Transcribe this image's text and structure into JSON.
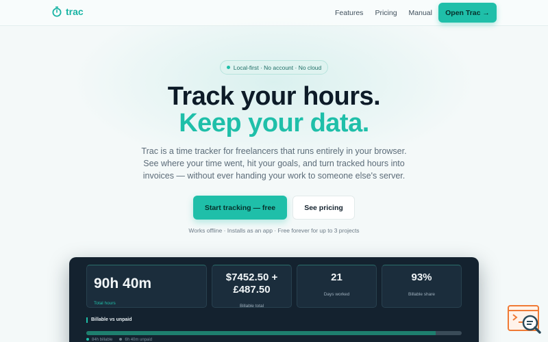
{
  "nav": {
    "brand": "trac",
    "links": [
      "Features",
      "Pricing",
      "Manual"
    ],
    "cta": "Open Trac →"
  },
  "hero": {
    "pill": "Local-first · No account · No cloud",
    "headline_1": "Track your hours.",
    "headline_2": "Keep your data.",
    "lede": "Trac is a time tracker for freelancers that runs entirely in your browser. See where your time went, hit your goals, and turn tracked hours into invoices — without ever handing your work to someone else's server.",
    "primary_button": "Start tracking — free",
    "secondary_button": "See pricing",
    "footnote": "Works offline · Installs as an app · Free forever for up to 3 projects"
  },
  "preview": {
    "stats": [
      {
        "value": "90h 40m",
        "label": "Total hours"
      },
      {
        "value": "$7452.50 + £487.50",
        "label": "Billable total"
      },
      {
        "value": "21",
        "label": "Days worked"
      },
      {
        "value": "93%",
        "label": "Billable share"
      }
    ],
    "billable_title": "Billable vs unpaid",
    "billable_fraction": 0.93,
    "legend": [
      "84h billable",
      "6h 40m unpaid"
    ]
  },
  "colors": {
    "accent": "#1fbfa9",
    "dark_panel": "#14222f",
    "background": "#f4f9f9"
  },
  "icons": {
    "brand": "stopwatch-icon",
    "floating": "search-document-icon"
  }
}
